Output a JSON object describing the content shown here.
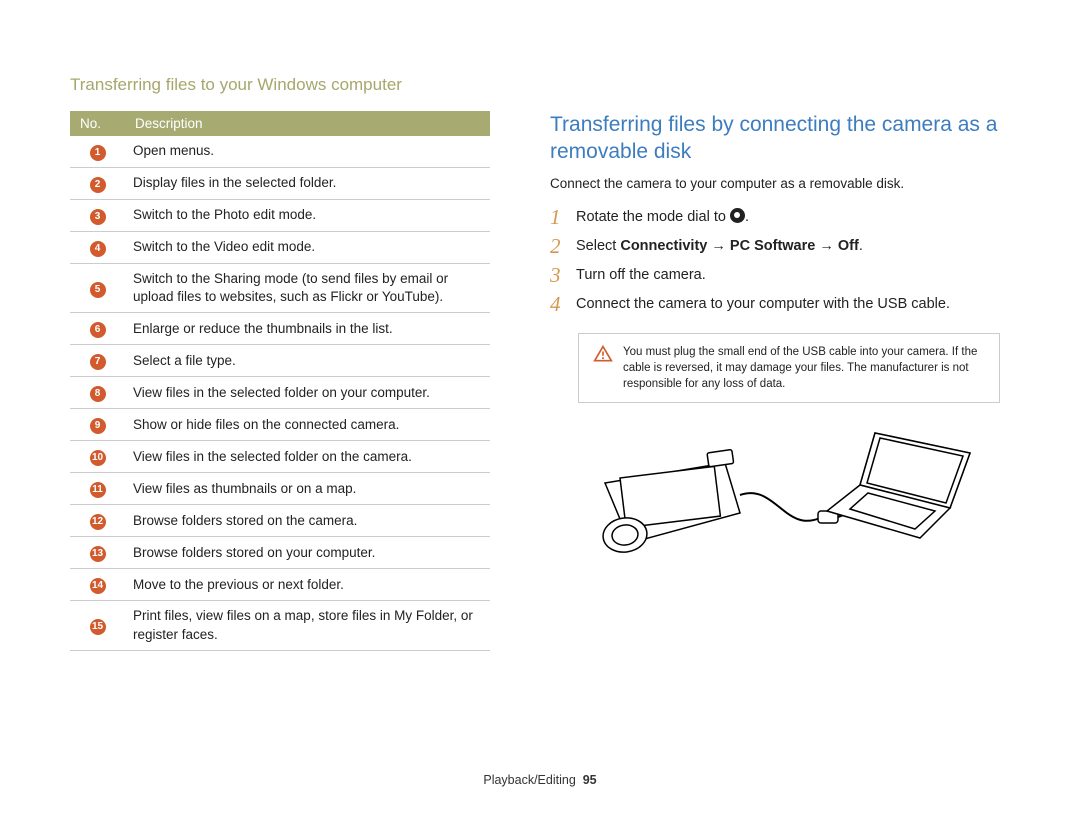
{
  "page_heading": "Transferring files to your Windows computer",
  "table": {
    "header_no": "No.",
    "header_desc": "Description",
    "rows": [
      {
        "n": "1",
        "text": "Open menus."
      },
      {
        "n": "2",
        "text": "Display files in the selected folder."
      },
      {
        "n": "3",
        "text": "Switch to the Photo edit mode."
      },
      {
        "n": "4",
        "text": "Switch to the Video edit mode."
      },
      {
        "n": "5",
        "text": "Switch to the Sharing mode (to send files by email or upload files to websites, such as Flickr or YouTube)."
      },
      {
        "n": "6",
        "text": "Enlarge or reduce the thumbnails in the list."
      },
      {
        "n": "7",
        "text": "Select a file type."
      },
      {
        "n": "8",
        "text": "View files in the selected folder on your computer."
      },
      {
        "n": "9",
        "text": "Show or hide files on the connected camera."
      },
      {
        "n": "10",
        "text": "View files in the selected folder on the camera."
      },
      {
        "n": "11",
        "text": "View files as thumbnails or on a map."
      },
      {
        "n": "12",
        "text": "Browse folders stored on the camera."
      },
      {
        "n": "13",
        "text": "Browse folders stored on your computer."
      },
      {
        "n": "14",
        "text": "Move to the previous or next folder."
      },
      {
        "n": "15",
        "text": "Print files, view files on a map, store files in My Folder, or register faces."
      }
    ]
  },
  "right": {
    "title": "Transferring files by connecting the camera as a removable disk",
    "intro": "Connect the camera to your computer as a removable disk.",
    "steps": {
      "s1": {
        "num": "1",
        "pre": "Rotate the mode dial to ",
        "post": "."
      },
      "s2": {
        "num": "2",
        "pre": "Select ",
        "b1": "Connectivity",
        "arrow1": " → ",
        "b2": "PC Software",
        "arrow2": " → ",
        "b3": "Off",
        "post": "."
      },
      "s3": {
        "num": "3",
        "text": "Turn off the camera."
      },
      "s4": {
        "num": "4",
        "text": "Connect the camera to your computer with the USB cable."
      }
    },
    "warning": "You must plug the small end of the USB cable into your camera. If the cable is reversed, it may damage your files. The manufacturer is not responsible for any loss of data."
  },
  "footer": {
    "section": "Playback/Editing",
    "page": "95"
  }
}
